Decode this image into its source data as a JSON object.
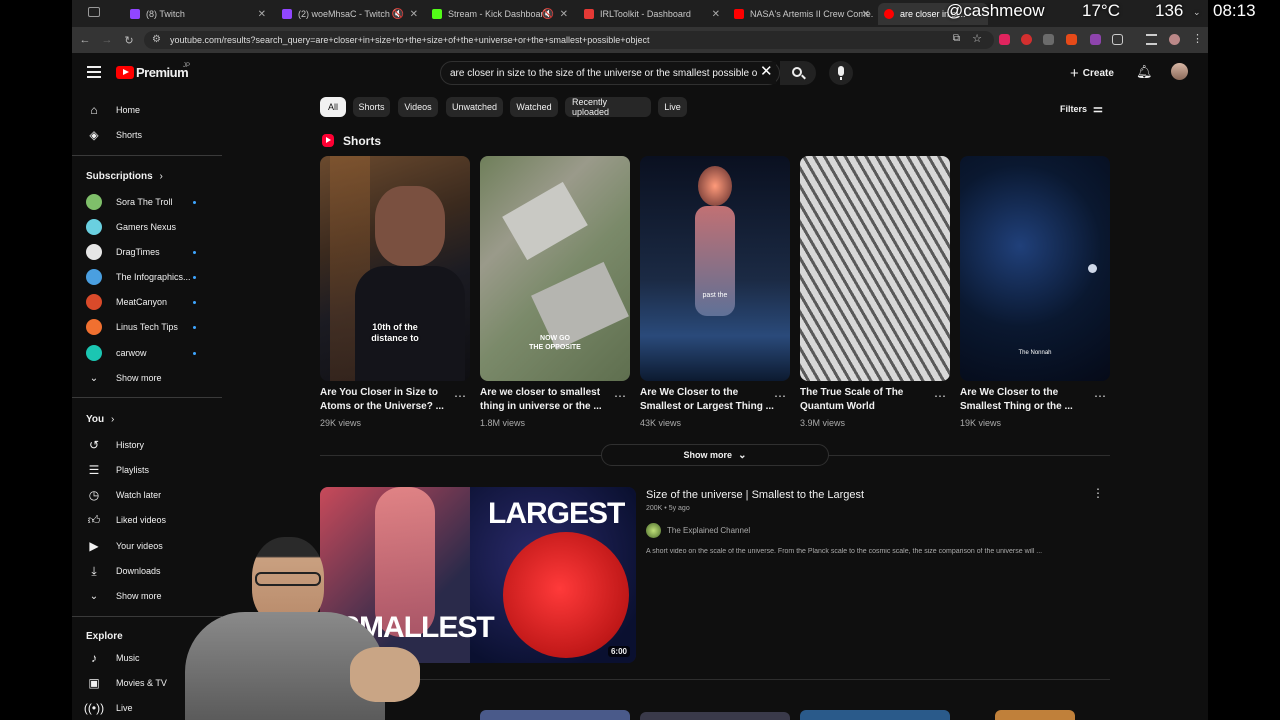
{
  "browser": {
    "tabs": [
      {
        "title": "(8) Twitch",
        "color": "#9146ff"
      },
      {
        "title": "(2) woeMhsaC - Twitch",
        "color": "#9146ff"
      },
      {
        "title": "Stream - Kick Dashboard",
        "color": "#53fc18"
      },
      {
        "title": "IRLToolkit - Dashboard",
        "color": "#e53935"
      },
      {
        "title": "NASA's Artemis II Crew Come...",
        "color": "#ff0000"
      },
      {
        "title": "are closer in si...",
        "color": "#ff0000"
      }
    ],
    "url": "youtube.com/results?search_query=are+closer+in+size+to+the+size+of+the+universe+or+the+smallest+possible+object"
  },
  "stream_overlay": {
    "handle": "@cashmeow",
    "temperature": "17°C",
    "count": "136",
    "time": "08:13"
  },
  "header": {
    "logo": "Premium",
    "logo_badge": "JP",
    "search_value": "are closer in size to the size of the universe or the smallest possible o",
    "create_label": "Create"
  },
  "sidebar": {
    "main": [
      {
        "label": "Home",
        "icon": "home-icon"
      },
      {
        "label": "Shorts",
        "icon": "shorts-icon"
      }
    ],
    "subscriptions_header": "Subscriptions",
    "subscriptions": [
      {
        "label": "Sora The Troll",
        "color": "#7fbf6a"
      },
      {
        "label": "Gamers Nexus",
        "color": "#6ad0e0"
      },
      {
        "label": "DragTimes",
        "color": "#e6e6e6"
      },
      {
        "label": "The Infographics...",
        "color": "#4a9fe0"
      },
      {
        "label": "MeatCanyon",
        "color": "#d94a2a"
      },
      {
        "label": "Linus Tech Tips",
        "color": "#f07030"
      },
      {
        "label": "carwow",
        "color": "#1bc6b2"
      }
    ],
    "subs_show_more": "Show more",
    "you_header": "You",
    "you_items": [
      {
        "label": "History",
        "icon": "history-icon"
      },
      {
        "label": "Playlists",
        "icon": "playlists-icon"
      },
      {
        "label": "Watch later",
        "icon": "watch-later-icon"
      },
      {
        "label": "Liked videos",
        "icon": "like-icon"
      },
      {
        "label": "Your videos",
        "icon": "your-videos-icon"
      },
      {
        "label": "Downloads",
        "icon": "download-icon"
      }
    ],
    "you_show_more": "Show more",
    "explore_header": "Explore",
    "explore_items": [
      {
        "label": "Music",
        "icon": "music-icon"
      },
      {
        "label": "Movies & TV",
        "icon": "movies-icon"
      },
      {
        "label": "Live",
        "icon": "live-icon"
      }
    ]
  },
  "filters": {
    "chips": [
      "All",
      "Shorts",
      "Videos",
      "Unwatched",
      "Watched",
      "Recently uploaded",
      "Live"
    ],
    "filters_label": "Filters"
  },
  "shorts": {
    "heading": "Shorts",
    "items": [
      {
        "title": "Are You Closer in Size to\nAtoms or the Universe? ...",
        "views": "29K views",
        "caption": "10th of the\ndistance to"
      },
      {
        "title": "Are we closer to smallest\nthing in universe or the ...",
        "views": "1.8M views",
        "caption": "NOW GO\nTHE OPPOSITE"
      },
      {
        "title": "Are We Closer to the\nSmallest or Largest Thing ...",
        "views": "43K views",
        "caption": "past the"
      },
      {
        "title": "The True Scale of The\nQuantum World",
        "views": "3.9M views",
        "caption": ""
      },
      {
        "title": "Are We Closer to the\nSmallest Thing or the ...",
        "views": "19K views",
        "caption": "The Nonnah"
      }
    ],
    "show_more": "Show more"
  },
  "video": {
    "title": "Size of the universe | Smallest to the Largest",
    "meta": "200K • 5y ago",
    "channel": "The Explained Channel",
    "description": "A short video on the scale of the universe. From the Planck scale to the cosmic scale, the size comparison of the universe will ...",
    "duration": "6:00",
    "thumb_top_text": "LARGEST",
    "thumb_bottom_text": "SMALLEST"
  }
}
